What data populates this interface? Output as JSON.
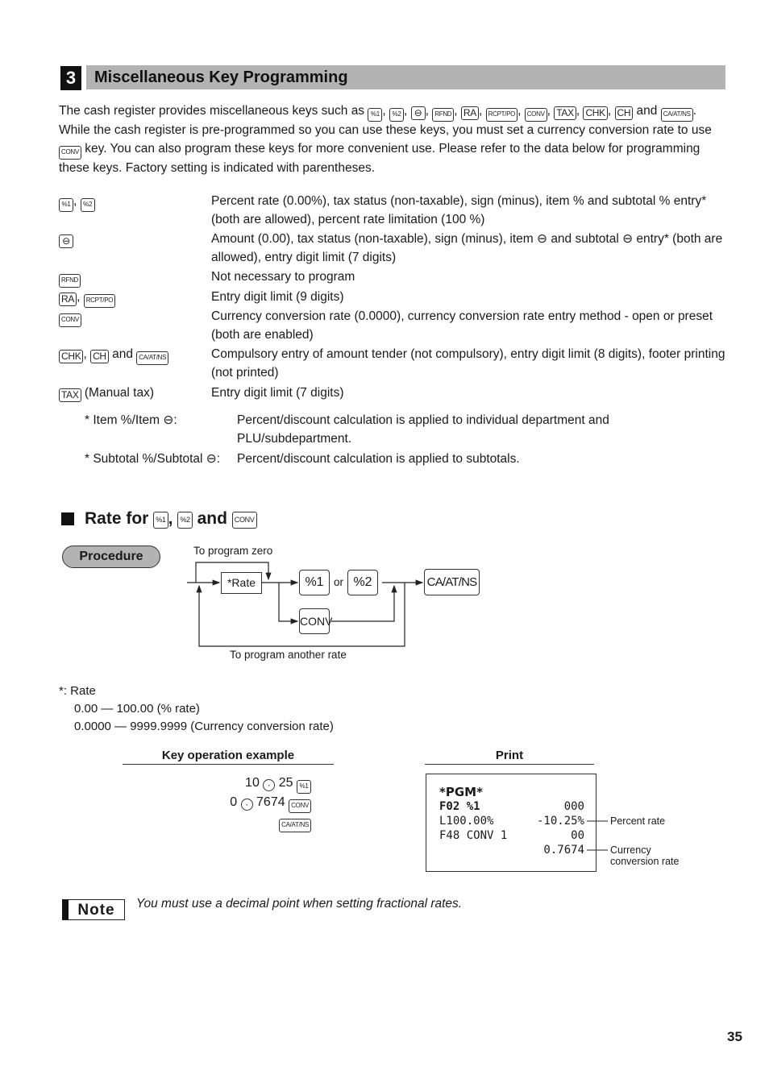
{
  "section": {
    "number": "3",
    "title": "Miscellaneous Key Programming"
  },
  "intro": {
    "p1_text": "The cash register provides miscellaneous keys such as",
    "keys": [
      "%1",
      "%2",
      "⊖",
      "RFND",
      "RA",
      "RCPT/PO",
      "CONV",
      "TAX",
      "CHK",
      "CH"
    ],
    "and_word": "and",
    "last_key": "CA/AT/NS",
    "p2_text": ". While the cash register is pre-programmed so you can use these keys, you must set a currency conversion rate to use",
    "conv_key": "CONV",
    "p3_text": "key. You can also program these keys for more convenient use. Please refer to the data below for programming these keys. Factory setting is indicated with parentheses."
  },
  "settings": [
    {
      "keys": [
        "%1",
        "%2"
      ],
      "suffix": "",
      "desc": "Percent rate (0.00%), tax status (non-taxable), sign (minus), item % and subtotal % entry* (both are allowed), percent rate limitation (100 %)"
    },
    {
      "keys": [
        "⊖"
      ],
      "suffix": "",
      "desc": "Amount (0.00), tax status (non-taxable), sign (minus), item ⊖ and subtotal ⊖ entry* (both are allowed), entry digit limit (7 digits)"
    },
    {
      "keys": [
        "RFND"
      ],
      "suffix": "",
      "desc": "Not necessary to program"
    },
    {
      "keys": [
        "RA",
        "RCPT/PO"
      ],
      "suffix": "",
      "desc": "Entry digit limit (9 digits)"
    },
    {
      "keys": [
        "CONV"
      ],
      "suffix": "",
      "desc": "Currency conversion rate (0.0000), currency conversion rate entry method - open or preset (both are enabled)"
    },
    {
      "keys": [
        "CHK",
        "CH",
        "CA/AT/NS"
      ],
      "suffix": "and",
      "desc": "Compulsory entry of amount tender (not compulsory), entry digit limit (8 digits), footer printing (not printed)"
    },
    {
      "keys": [
        "TAX"
      ],
      "suffix": "(Manual tax)",
      "desc": "Entry digit limit (7 digits)"
    }
  ],
  "footnotes": [
    {
      "label": "* Item %/Item ⊖:",
      "desc": "Percent/discount calculation is applied to individual department and PLU/subdepartment."
    },
    {
      "label": "* Subtotal %/Subtotal ⊖:",
      "desc": "Percent/discount calculation is applied to subtotals."
    }
  ],
  "rate_section": {
    "prefix": "Rate for",
    "key1": "%1",
    "comma": ",",
    "key2": "%2",
    "and_word": "and",
    "key3": "CONV"
  },
  "procedure": {
    "label": "Procedure",
    "to_program_zero": "To program zero",
    "rate_box": "*Rate",
    "key_pct1": "%1",
    "or_word": "or",
    "key_pct2": "%2",
    "key_conv": "CONV",
    "key_finalize": "CA/AT/NS",
    "to_program_another": "To program another rate"
  },
  "rate_note": {
    "title": "*:  Rate",
    "line1": "0.00 — 100.00 (% rate)",
    "line2": "0.0000 — 9999.9999 (Currency conversion rate)"
  },
  "key_example": {
    "heading": "Key operation example",
    "line1_a": "10",
    "line1_b": "25",
    "line1_key": "%1",
    "line2_a": "0",
    "line2_b": "7674",
    "line2_key": "CONV",
    "line3_key": "CA/AT/NS",
    "dot": "·"
  },
  "print": {
    "heading": "Print",
    "lines": [
      {
        "left": "*PGM*",
        "right": ""
      },
      {
        "left": "F02 %1",
        "right": "000"
      },
      {
        "left": "L100.00%",
        "right": "-10.25%"
      },
      {
        "left": "F48 CONV 1",
        "right": "00"
      },
      {
        "left": "",
        "right": "0.7674"
      }
    ],
    "callout_percent": "Percent rate",
    "callout_currency_1": "Currency",
    "callout_currency_2": "conversion rate"
  },
  "note": {
    "label": "Note",
    "text": "You must use a decimal point when setting fractional rates."
  },
  "page_number": "35"
}
